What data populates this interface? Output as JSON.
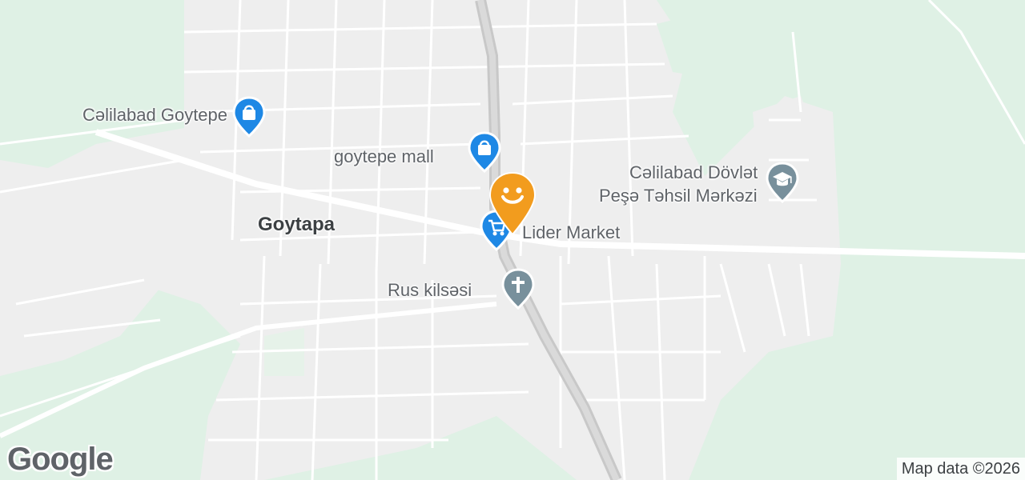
{
  "map": {
    "town_label": "Goytapa",
    "places": [
      {
        "name": "Cəlilabad Goytepe",
        "icon": "shopping-bag-icon"
      },
      {
        "name": "goytepe mall",
        "icon": "shopping-bag-icon"
      },
      {
        "name": "Lider Market",
        "icon": "shopping-cart-icon"
      },
      {
        "name": "Rus kilsəsi",
        "icon": "church-cross-icon"
      },
      {
        "name": "Cəlilabad Dövlət",
        "name_line2": "Peşə Təhsil Mərkəzi",
        "icon": "graduation-cap-icon"
      }
    ],
    "selected_marker_icon": "smiley-face-icon"
  },
  "branding": {
    "logo_text": "Google",
    "attribution": "Map data ©2026"
  },
  "colors": {
    "land": "#eeeeee",
    "park": "#dff1e5",
    "road": "#ffffff",
    "highway": "#c8c8c8",
    "shopping_pin": "#1e88e5",
    "education_pin": "#78909c",
    "selected_pin": "#f29c1e"
  }
}
